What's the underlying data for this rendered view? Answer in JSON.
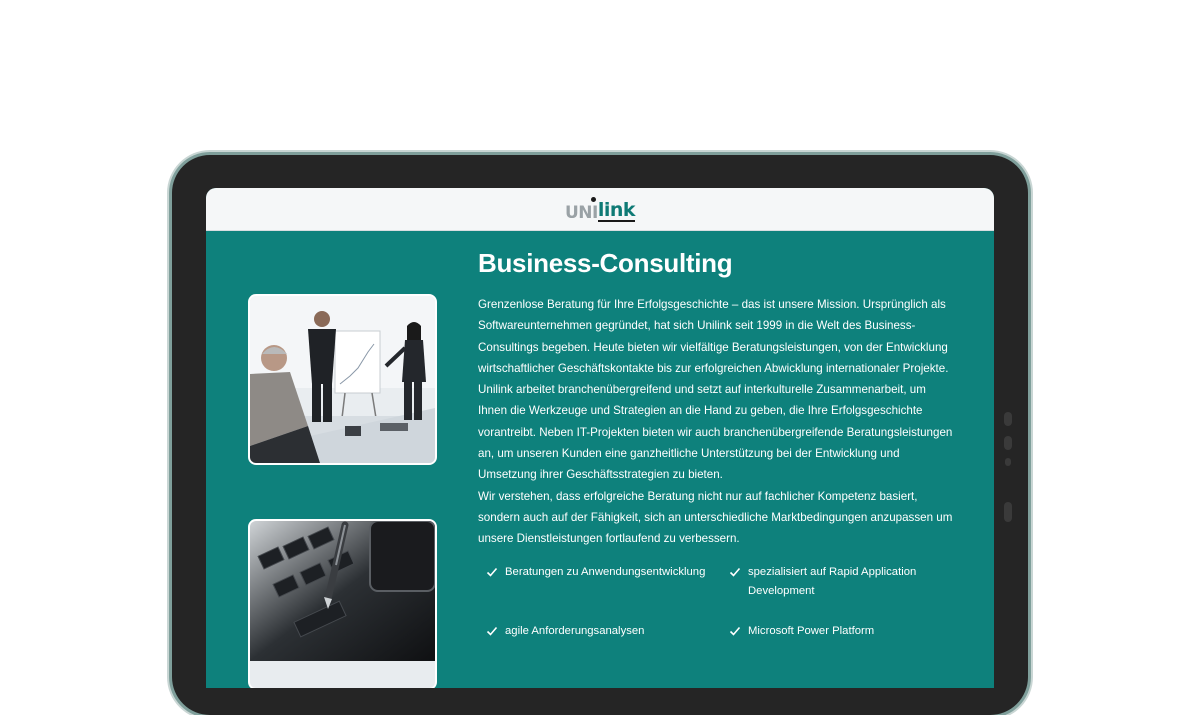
{
  "brand": {
    "logo_prefix": "UNI",
    "logo_suffix": "link"
  },
  "main": {
    "title": "Business-Consulting",
    "paragraph_1": "Grenzenlose Beratung für Ihre Erfolgsgeschichte – das ist unsere Mission. Ursprünglich als Softwareunternehmen gegründet, hat sich Unilink seit 1999 in die Welt des Business-Consultings begeben. Heute bieten wir vielfältige Beratungsleistungen, von der Entwicklung wirtschaftlicher Geschäftskontakte bis zur erfolgreichen Abwicklung internationaler Projekte. Unilink arbeitet branchenübergreifend und setzt auf interkulturelle Zusammenarbeit, um Ihnen die Werkzeuge und Strategien an die Hand zu geben, die Ihre Erfolgsgeschichte vorantreibt. Neben IT-Projekten bieten wir auch branchenübergreifende Beratungsleistungen an, um unseren Kunden eine ganzheitliche Unterstützung bei der Entwicklung und Umsetzung ihrer Geschäftsstrategien zu bieten.",
    "paragraph_2": "Wir verstehen, dass erfolgreiche Beratung nicht nur auf fachlicher Kompetenz basiert, sondern auch auf der Fähigkeit, sich an unterschiedliche Marktbedingungen anzupassen um unsere Dienstleistungen fortlaufend zu verbessern."
  },
  "features": [
    "Beratungen zu Anwendungsentwicklung",
    "spezialisiert auf Rapid Application Development",
    "agile Anforderungsanalysen",
    "Microsoft Power Platform"
  ],
  "colors": {
    "accent": "#0e817c",
    "header_bg": "#f5f7f8",
    "device_frame": "#252525",
    "text": "#ffffff"
  },
  "icons": {
    "feature_bullet": "check-icon"
  }
}
